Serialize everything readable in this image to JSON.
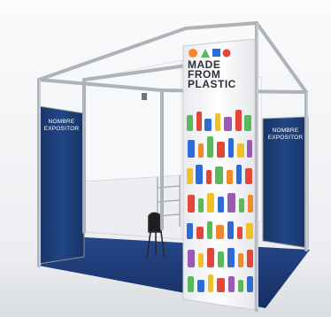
{
  "booth": {
    "brand_logo_text": [
      "MADE",
      "FROM",
      "PLASTIC"
    ],
    "left_panel_text": [
      "NOMBRE",
      "EXPOSITOR"
    ],
    "right_panel_text": [
      "NOMBRE",
      "EXPOSITOR"
    ]
  },
  "colors": {
    "frame": "#b9bdc3",
    "panel_blue": "#1d3f7a",
    "carpet": "#1f3b73",
    "wall": "#f4f5f7",
    "logo_orange": "#f08a2a",
    "logo_green": "#5cb85c",
    "logo_blue": "#2d6bd6",
    "logo_red": "#e2473a"
  }
}
